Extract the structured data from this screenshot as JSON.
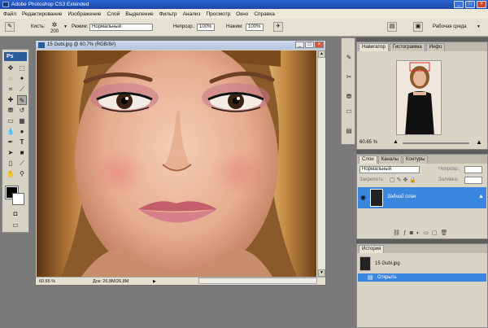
{
  "app": {
    "title": "Adobe Photoshop CS3 Extended",
    "window_buttons": [
      "_",
      "□",
      "×"
    ]
  },
  "menu": [
    "Файл",
    "Редактирование",
    "Изображение",
    "Слой",
    "Выделение",
    "Фильтр",
    "Анализ",
    "Просмотр",
    "Окно",
    "Справка"
  ],
  "options": {
    "brush_label": "Кисть:",
    "brush_size": "200",
    "mode_label": "Режим:",
    "mode_value": "Нормальный",
    "opacity_label": "Непрозр.:",
    "opacity_value": "100%",
    "flow_label": "Нажим:",
    "flow_value": "100%",
    "workspace_label": "Рабочая среда"
  },
  "toolbox": {
    "logo": "Ps"
  },
  "document": {
    "title": "15 Gubi.jpg @ 60,7% (RGB/8#)",
    "zoom": "60.65 %",
    "doc_size": "Док: 26,8M/26,8M"
  },
  "navigator": {
    "tabs": [
      "Навигатор",
      "Гистограмма",
      "Инфо"
    ],
    "zoom": "60.65 %"
  },
  "layers": {
    "tabs": [
      "Слои",
      "Каналы",
      "Контуры"
    ],
    "blend_mode": "Нормальный",
    "opacity_label": "Непрозр.:",
    "lock_label": "Закрепить:",
    "fill_label": "Заливка:",
    "layer_name": "Задний план"
  },
  "history": {
    "tabs": [
      "История"
    ],
    "snapshot": "15 Gubi.jpg",
    "step": "Открыть"
  },
  "colors": {
    "selection": "#3b87e0",
    "titlebar": "#2c63d0"
  }
}
